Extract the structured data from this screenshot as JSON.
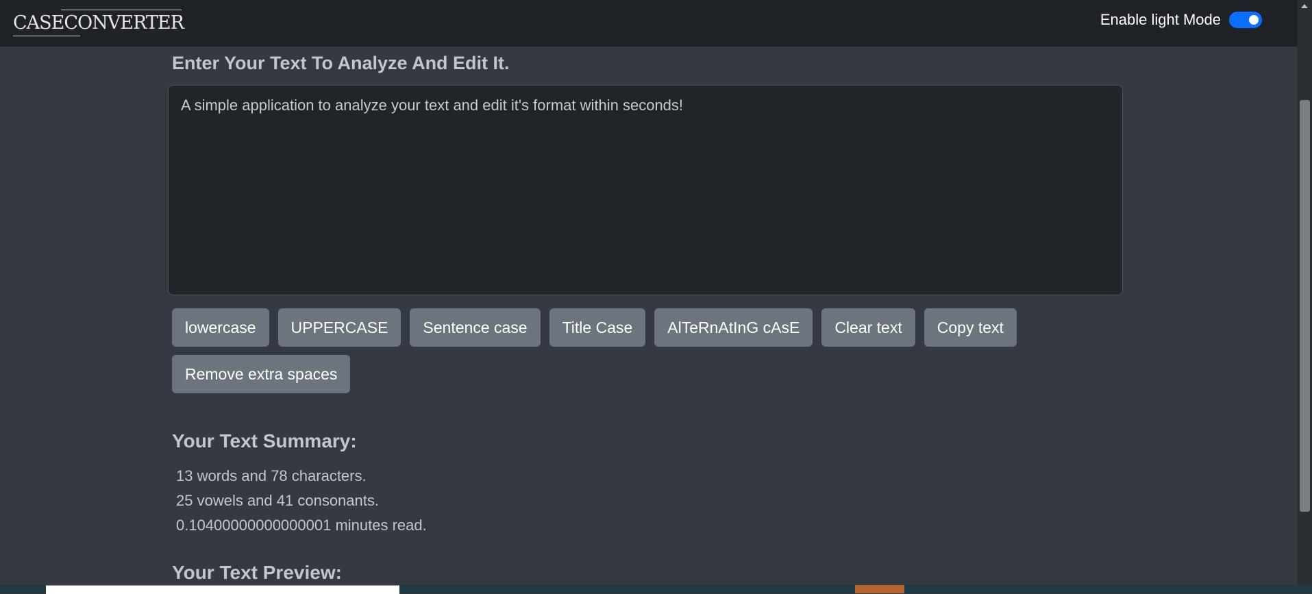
{
  "navbar": {
    "brand": "CASECONVERTER",
    "toggle_label": "Enable light Mode",
    "toggle_on": true
  },
  "editor": {
    "heading": "Enter Your Text To Analyze And Edit It.",
    "text": "A simple application to analyze your text and edit it's format within seconds!"
  },
  "buttons": {
    "lowercase": "lowercase",
    "uppercase": "UPPERCASE",
    "sentence": "Sentence case",
    "title": "Title Case",
    "alternating": "AlTeRnAtInG cAsE",
    "clear": "Clear text",
    "copy": "Copy text",
    "remove_spaces": "Remove extra spaces"
  },
  "summary": {
    "title": "Your Text Summary:",
    "words_line": "13 words and 78 characters.",
    "letters_line": "25 vowels and 41 consonants.",
    "read_line": "0.10400000000000001 minutes read."
  },
  "preview": {
    "title": "Your Text Preview:"
  },
  "colors": {
    "page_bg": "#353a42",
    "navbar_bg": "#1f2226",
    "accent": "#0d6efd",
    "button_bg": "#6c757d"
  }
}
